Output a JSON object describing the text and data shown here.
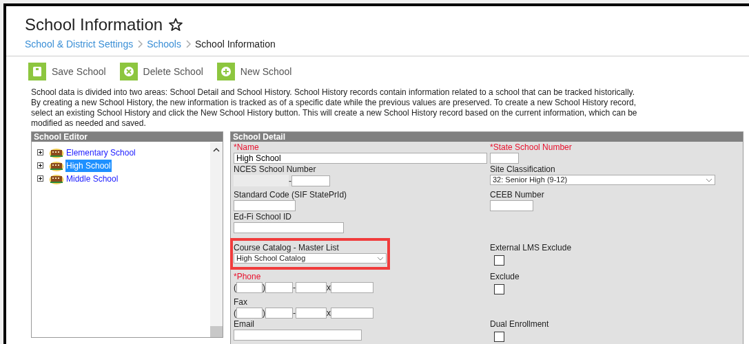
{
  "page": {
    "title": "School Information",
    "favorite": false
  },
  "breadcrumb": [
    {
      "label": "School & District Settings",
      "current": false
    },
    {
      "label": "Schools",
      "current": false
    },
    {
      "label": "School Information",
      "current": true
    }
  ],
  "toolbar": [
    {
      "kind": "save",
      "label": "Save School"
    },
    {
      "kind": "delete",
      "label": "Delete School"
    },
    {
      "kind": "new",
      "label": "New School"
    }
  ],
  "description": "School data is divided into two areas: School Detail and School History. School History records contain information related to a school that can be tracked historically. By creating a new School History, the new information is tracked as of a specific date while the previous values are preserved. To create a new School History record, select an existing School History and click the New School History button. This will create a new School History record based on the current information, which can be modified as needed and saved.",
  "school_editor": {
    "title": "School Editor",
    "items": [
      {
        "label": "Elementary School",
        "expanded": false,
        "selected": false
      },
      {
        "label": "High School",
        "expanded": false,
        "selected": true
      },
      {
        "label": "Middle School",
        "expanded": false,
        "selected": false
      }
    ]
  },
  "school_detail": {
    "title": "School Detail",
    "rows": [
      [
        {
          "kind": "text",
          "label": "*Name",
          "required": true,
          "value": "High School"
        },
        {
          "kind": "text",
          "label": "*State School Number",
          "required": true
        }
      ],
      [
        {
          "kind": "split",
          "label": "NCES School Number",
          "separator": "-"
        },
        {
          "kind": "select",
          "label": "Site Classification",
          "value": "32: Senior High (9-12)"
        }
      ],
      [
        {
          "kind": "text",
          "label": "Standard Code (SIF StatePrId)",
          "required": false
        },
        {
          "kind": "text",
          "label": "CEEB Number",
          "required": false
        }
      ],
      [
        {
          "kind": "text",
          "label": "Ed-Fi School ID",
          "required": false
        },
        null
      ],
      [
        {
          "kind": "select",
          "label": "Course Catalog - Master List",
          "value": "High School Catalog",
          "highlighted": true
        },
        {
          "kind": "checkbox",
          "label": "External LMS Exclude",
          "checked": false
        }
      ],
      [
        {
          "kind": "phone",
          "label": "*Phone",
          "required": true,
          "separators": [
            "(",
            ")",
            "-",
            "x"
          ]
        },
        {
          "kind": "checkbox",
          "label": "Exclude",
          "checked": false
        }
      ],
      [
        {
          "kind": "phone",
          "label": "Fax",
          "required": false,
          "separators": [
            "(",
            ")",
            "-",
            "x"
          ]
        },
        null
      ],
      [
        {
          "kind": "text",
          "label": "Email",
          "required": false
        },
        {
          "kind": "checkbox",
          "label": "Dual Enrollment",
          "checked": false
        }
      ]
    ]
  }
}
